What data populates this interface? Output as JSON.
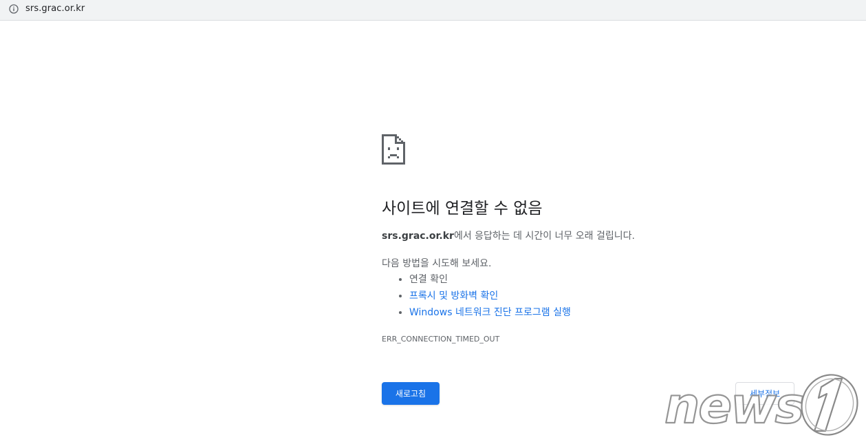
{
  "address_bar": {
    "url": "srs.grac.or.kr",
    "icon": "info-icon"
  },
  "error_page": {
    "icon": "sad-page-icon",
    "heading": "사이트에 연결할 수 없음",
    "host": "srs.grac.or.kr",
    "description_suffix": "에서 응답하는 데 시간이 너무 오래 걸립니다.",
    "try_text": "다음 방법을 시도해 보세요.",
    "suggestions": [
      {
        "label": "연결 확인",
        "link": false
      },
      {
        "label": "프록시 및 방화벽 확인",
        "link": true
      },
      {
        "label": "Windows 네트워크 진단 프로그램 실행",
        "link": true
      }
    ],
    "error_code": "ERR_CONNECTION_TIMED_OUT",
    "reload_label": "새로고침",
    "details_label": "세부정보"
  },
  "watermark": {
    "text": "news1"
  },
  "colors": {
    "accent": "#1a73e8",
    "text_secondary": "#5f6368",
    "bar_bg": "#f1f3f4"
  }
}
